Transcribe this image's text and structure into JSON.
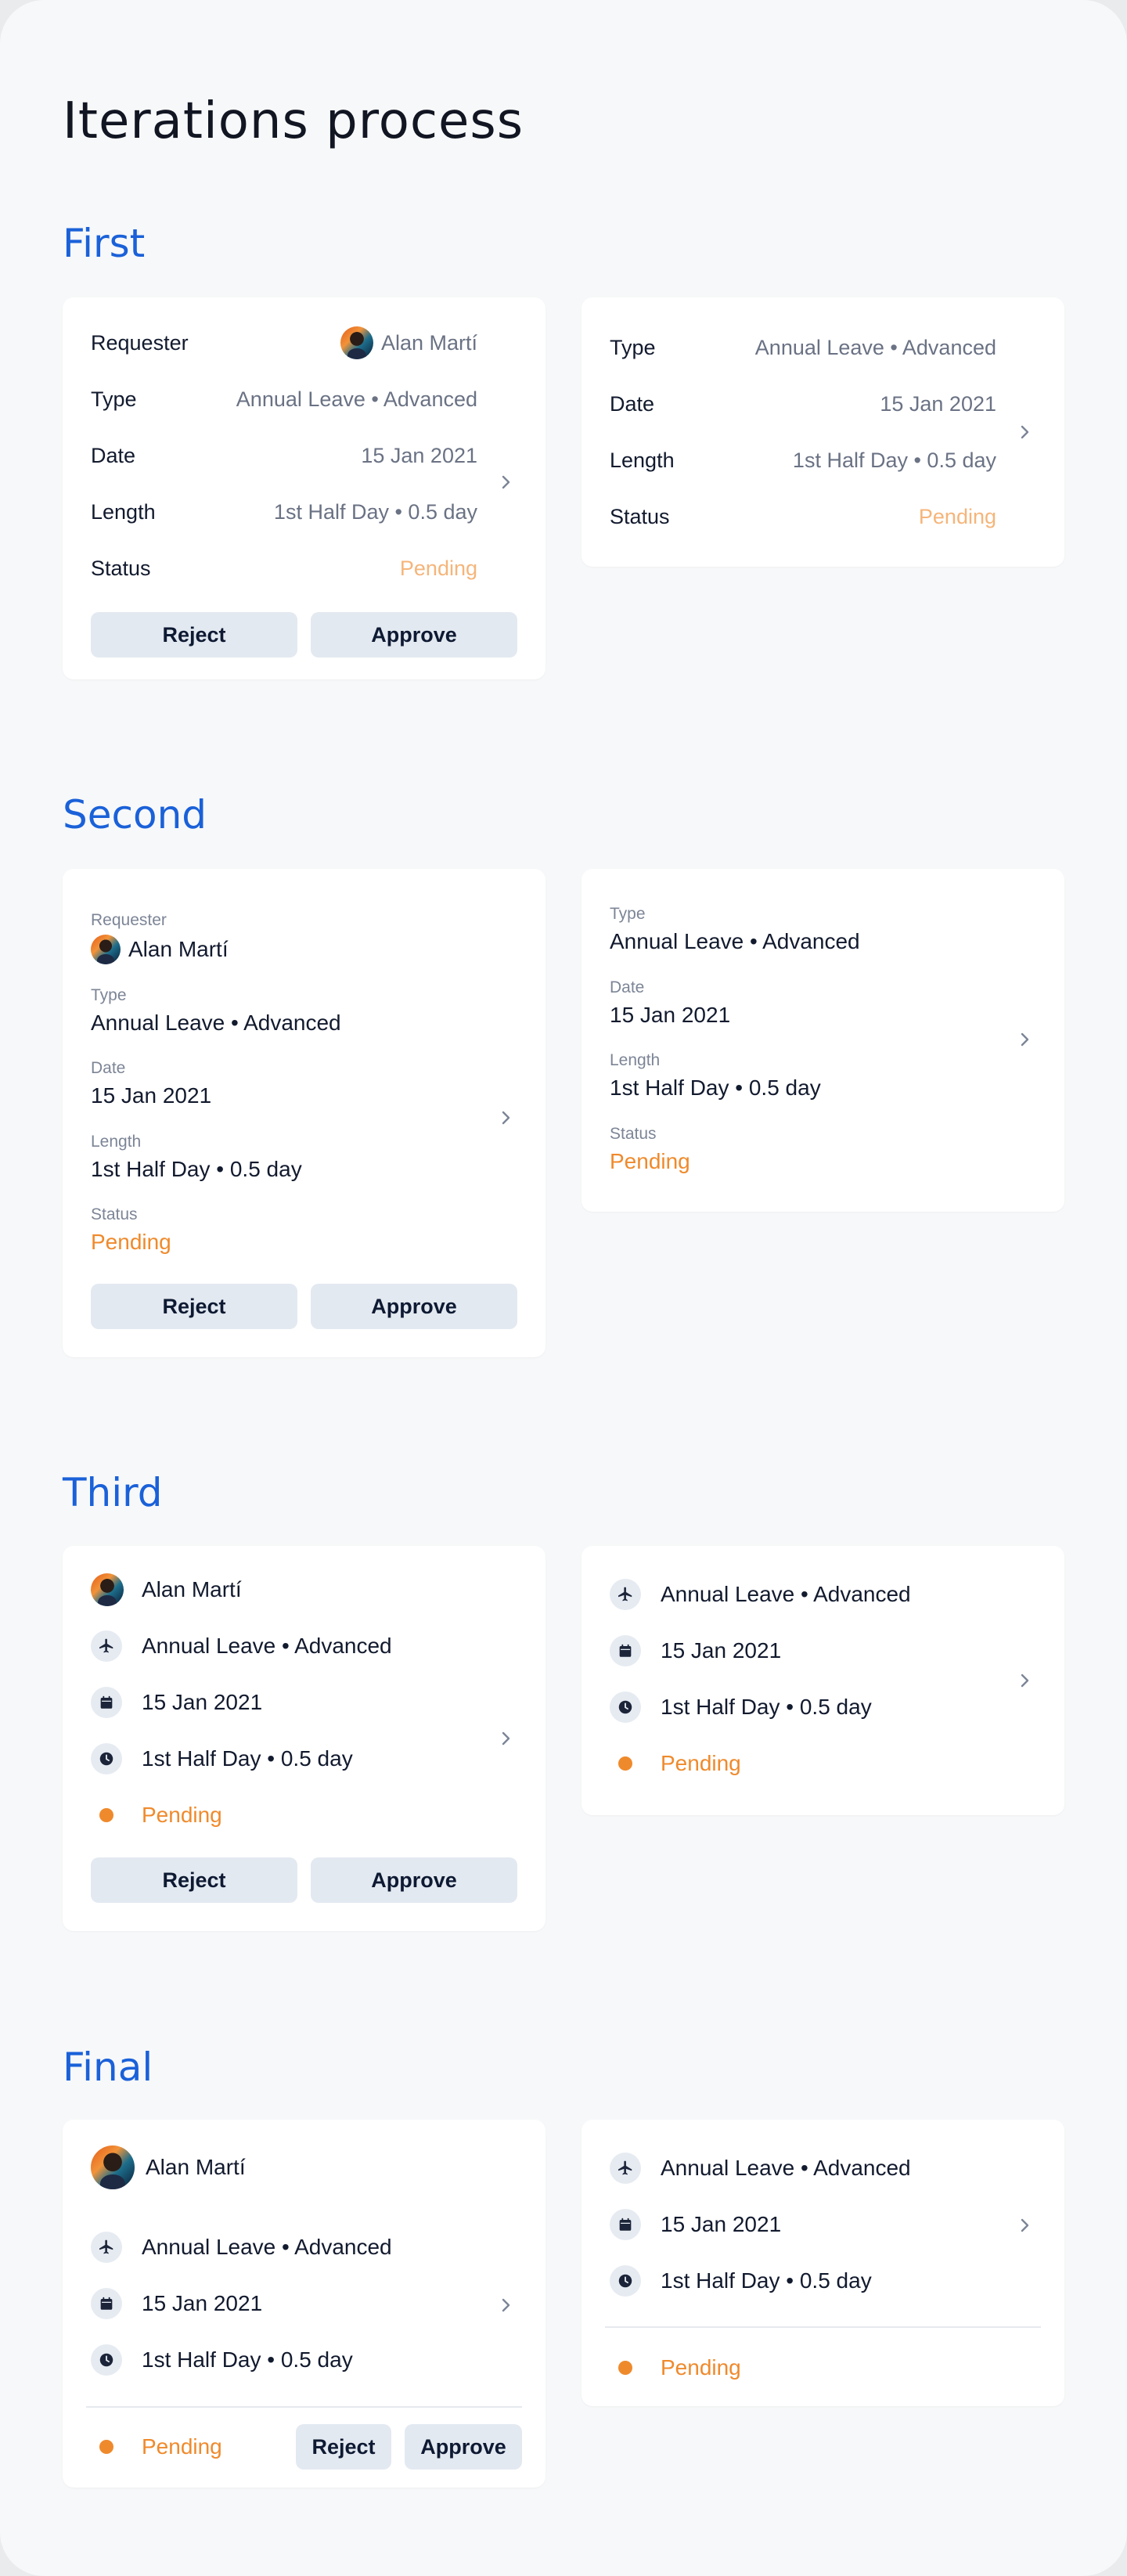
{
  "page": {
    "title": "Iterations process"
  },
  "common": {
    "requester_label": "Requester",
    "type_label": "Type",
    "date_label": "Date",
    "length_label": "Length",
    "status_label": "Status",
    "requester_name": "Alan Martí",
    "type_value": "Annual Leave • Advanced",
    "date_value": "15 Jan 2021",
    "length_value": "1st Half Day • 0.5 day",
    "status_value": "Pending",
    "reject_label": "Reject",
    "approve_label": "Approve"
  },
  "sections": [
    {
      "title": "First"
    },
    {
      "title": "Second"
    },
    {
      "title": "Third"
    },
    {
      "title": "Final"
    }
  ],
  "icons": {
    "chevron": "chevron-right-icon",
    "type": "airplane-icon",
    "date": "calendar-icon",
    "length": "clock-icon",
    "status": "status-dot"
  },
  "colors": {
    "section_title": "#1a61d9",
    "pending_strong": "#ef8a2c",
    "pending_light": "#f5b57a",
    "button_bg": "#e3e9f0",
    "background": "#f7f8f9"
  }
}
